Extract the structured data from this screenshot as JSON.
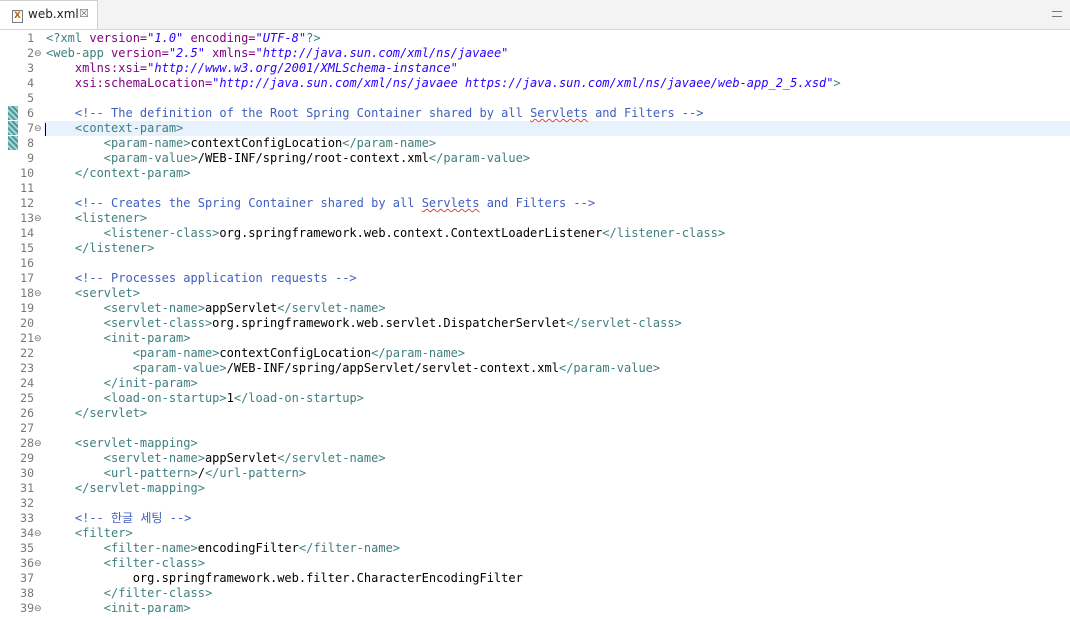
{
  "tab": {
    "title": "web.xml",
    "icon": "xml-file-icon",
    "close_glyph": "☒"
  },
  "lines": [
    {
      "n": "1",
      "fold": "",
      "segs": [
        [
          "pi",
          "<?xml "
        ],
        [
          "attr",
          "version="
        ],
        [
          "val",
          "\"1.0\""
        ],
        [
          "attr",
          " encoding="
        ],
        [
          "val",
          "\"UTF-8\""
        ],
        [
          "pi",
          "?>"
        ]
      ]
    },
    {
      "n": "2",
      "fold": "⊖",
      "segs": [
        [
          "tag",
          "<web-app "
        ],
        [
          "attr",
          "version="
        ],
        [
          "val",
          "\"2.5\""
        ],
        [
          "attr",
          " xmlns="
        ],
        [
          "val",
          "\"http://java.sun.com/xml/ns/javaee\""
        ]
      ]
    },
    {
      "n": "3",
      "fold": "",
      "segs": [
        [
          "attr",
          "    xmlns:xsi="
        ],
        [
          "val",
          "\"http://www.w3.org/2001/XMLSchema-instance\""
        ]
      ]
    },
    {
      "n": "4",
      "fold": "",
      "segs": [
        [
          "attr",
          "    xsi:schemaLocation="
        ],
        [
          "val",
          "\"http://java.sun.com/xml/ns/javaee https://java.sun.com/xml/ns/javaee/web-app_2_5.xsd\""
        ],
        [
          "tag",
          ">"
        ]
      ]
    },
    {
      "n": "5",
      "fold": "",
      "segs": []
    },
    {
      "n": "6",
      "fold": "",
      "segs": [
        [
          "cmt",
          "    <!-- The definition of the Root Spring Container shared by all "
        ],
        [
          "cmt spell",
          "Servlets"
        ],
        [
          "cmt",
          " and Filters -->"
        ]
      ]
    },
    {
      "n": "7",
      "fold": "⊖",
      "segs": [
        [
          "tag",
          "    <context-param>"
        ]
      ]
    },
    {
      "n": "8",
      "fold": "",
      "segs": [
        [
          "tag",
          "        <param-name>"
        ],
        [
          "txt",
          "contextConfigLocation"
        ],
        [
          "tag",
          "</param-name>"
        ]
      ]
    },
    {
      "n": "9",
      "fold": "",
      "segs": [
        [
          "tag",
          "        <param-value>"
        ],
        [
          "txt",
          "/WEB-INF/spring/root-context.xml"
        ],
        [
          "tag",
          "</param-value>"
        ]
      ]
    },
    {
      "n": "10",
      "fold": "",
      "segs": [
        [
          "tag",
          "    </context-param>"
        ]
      ]
    },
    {
      "n": "11",
      "fold": "",
      "segs": []
    },
    {
      "n": "12",
      "fold": "",
      "segs": [
        [
          "cmt",
          "    <!-- Creates the Spring Container shared by all "
        ],
        [
          "cmt spell",
          "Servlets"
        ],
        [
          "cmt",
          " and Filters -->"
        ]
      ]
    },
    {
      "n": "13",
      "fold": "⊖",
      "segs": [
        [
          "tag",
          "    <listener>"
        ]
      ]
    },
    {
      "n": "14",
      "fold": "",
      "segs": [
        [
          "tag",
          "        <listener-class>"
        ],
        [
          "txt",
          "org.springframework.web.context.ContextLoaderListener"
        ],
        [
          "tag",
          "</listener-class>"
        ]
      ]
    },
    {
      "n": "15",
      "fold": "",
      "segs": [
        [
          "tag",
          "    </listener>"
        ]
      ]
    },
    {
      "n": "16",
      "fold": "",
      "segs": []
    },
    {
      "n": "17",
      "fold": "",
      "segs": [
        [
          "cmt",
          "    <!-- Processes application requests -->"
        ]
      ]
    },
    {
      "n": "18",
      "fold": "⊖",
      "segs": [
        [
          "tag",
          "    <servlet>"
        ]
      ]
    },
    {
      "n": "19",
      "fold": "",
      "segs": [
        [
          "tag",
          "        <servlet-name>"
        ],
        [
          "txt",
          "appServlet"
        ],
        [
          "tag",
          "</servlet-name>"
        ]
      ]
    },
    {
      "n": "20",
      "fold": "",
      "segs": [
        [
          "tag",
          "        <servlet-class>"
        ],
        [
          "txt",
          "org.springframework.web.servlet.DispatcherServlet"
        ],
        [
          "tag",
          "</servlet-class>"
        ]
      ]
    },
    {
      "n": "21",
      "fold": "⊖",
      "segs": [
        [
          "tag",
          "        <init-param>"
        ]
      ]
    },
    {
      "n": "22",
      "fold": "",
      "segs": [
        [
          "tag",
          "            <param-name>"
        ],
        [
          "txt",
          "contextConfigLocation"
        ],
        [
          "tag",
          "</param-name>"
        ]
      ]
    },
    {
      "n": "23",
      "fold": "",
      "segs": [
        [
          "tag",
          "            <param-value>"
        ],
        [
          "txt",
          "/WEB-INF/spring/appServlet/servlet-context.xml"
        ],
        [
          "tag",
          "</param-value>"
        ]
      ]
    },
    {
      "n": "24",
      "fold": "",
      "segs": [
        [
          "tag",
          "        </init-param>"
        ]
      ]
    },
    {
      "n": "25",
      "fold": "",
      "segs": [
        [
          "tag",
          "        <load-on-startup>"
        ],
        [
          "txt",
          "1"
        ],
        [
          "tag",
          "</load-on-startup>"
        ]
      ]
    },
    {
      "n": "26",
      "fold": "",
      "segs": [
        [
          "tag",
          "    </servlet>"
        ]
      ]
    },
    {
      "n": "27",
      "fold": "",
      "segs": []
    },
    {
      "n": "28",
      "fold": "⊖",
      "segs": [
        [
          "tag",
          "    <servlet-mapping>"
        ]
      ]
    },
    {
      "n": "29",
      "fold": "",
      "segs": [
        [
          "tag",
          "        <servlet-name>"
        ],
        [
          "txt",
          "appServlet"
        ],
        [
          "tag",
          "</servlet-name>"
        ]
      ]
    },
    {
      "n": "30",
      "fold": "",
      "segs": [
        [
          "tag",
          "        <url-pattern>"
        ],
        [
          "txt",
          "/"
        ],
        [
          "tag",
          "</url-pattern>"
        ]
      ]
    },
    {
      "n": "31",
      "fold": "",
      "segs": [
        [
          "tag",
          "    </servlet-mapping>"
        ]
      ]
    },
    {
      "n": "32",
      "fold": "",
      "segs": []
    },
    {
      "n": "33",
      "fold": "",
      "segs": [
        [
          "cmt",
          "    <!-- 한글 세팅 -->"
        ]
      ]
    },
    {
      "n": "34",
      "fold": "⊖",
      "segs": [
        [
          "tag",
          "    <filter>"
        ]
      ]
    },
    {
      "n": "35",
      "fold": "",
      "segs": [
        [
          "tag",
          "        <filter-name>"
        ],
        [
          "txt",
          "encodingFilter"
        ],
        [
          "tag",
          "</filter-name>"
        ]
      ]
    },
    {
      "n": "36",
      "fold": "⊖",
      "segs": [
        [
          "tag",
          "        <filter-class>"
        ]
      ]
    },
    {
      "n": "37",
      "fold": "",
      "segs": [
        [
          "txt",
          "            org.springframework.web.filter.CharacterEncodingFilter"
        ]
      ]
    },
    {
      "n": "38",
      "fold": "",
      "segs": [
        [
          "tag",
          "        </filter-class>"
        ]
      ]
    },
    {
      "n": "39",
      "fold": "⊖",
      "segs": [
        [
          "tag",
          "        <init-param>"
        ]
      ]
    }
  ],
  "colors": {
    "tag": "#3f7f7f",
    "attribute": "#7f007f",
    "value": "#2a00ff",
    "comment": "#3f5fbf",
    "current_line": "#e8f2fe"
  }
}
